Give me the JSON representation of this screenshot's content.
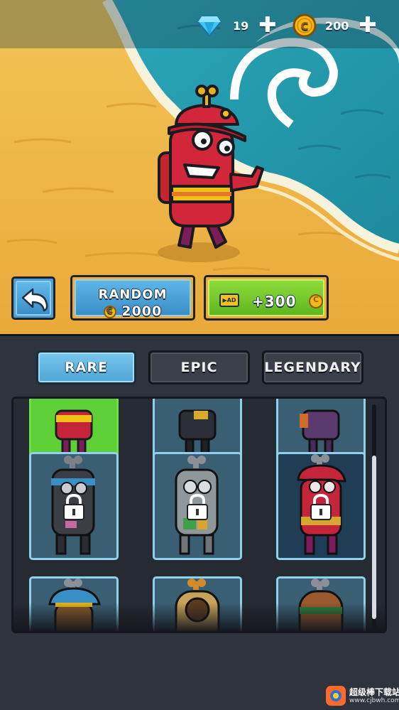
{
  "hud": {
    "gems": "19",
    "coins": "200",
    "gem_icon": "diamond-icon",
    "coin_icon": "coin-icon",
    "add_icon": "plus-icon"
  },
  "actions": {
    "back_icon": "back-arrow-icon",
    "random_label": "RANDOM",
    "random_cost": "2000",
    "ad_badge": "AD",
    "ad_reward": "+300"
  },
  "tabs": [
    {
      "label": "RARE",
      "active": true
    },
    {
      "label": "EPIC",
      "active": false
    },
    {
      "label": "LEGENDARY",
      "active": false
    }
  ],
  "characters": [
    {
      "row": 1,
      "col": 1,
      "state": "selected",
      "color": "red"
    },
    {
      "row": 1,
      "col": 2,
      "state": "owned",
      "color": "dark-grey"
    },
    {
      "row": 1,
      "col": 3,
      "state": "owned",
      "color": "purple"
    },
    {
      "row": 2,
      "col": 1,
      "state": "locked",
      "color": "black"
    },
    {
      "row": 2,
      "col": 2,
      "state": "locked",
      "color": "grey-robot"
    },
    {
      "row": 2,
      "col": 3,
      "state": "locked",
      "color": "red-firefighter"
    },
    {
      "row": 3,
      "col": 1,
      "state": "locked",
      "color": "blue-hat"
    },
    {
      "row": 3,
      "col": 2,
      "state": "locked",
      "color": "diver"
    },
    {
      "row": 3,
      "col": 3,
      "state": "locked",
      "color": "brown"
    }
  ],
  "watermark": {
    "name": "超级棒下载站",
    "url": "www.cjbwh.com"
  },
  "colors": {
    "sand": "#f1bb47",
    "sea": "#2fb3ba",
    "tab_active": "#5fb2df",
    "ad_green": "#7ccf2d",
    "panel": "#2f333d"
  }
}
